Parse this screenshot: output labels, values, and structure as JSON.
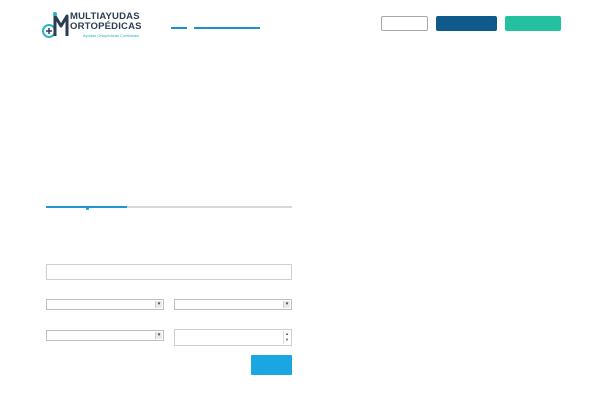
{
  "brand": {
    "name_line1": "MULTIAYUDAS",
    "name_line2": "ORTOPÉDICAS",
    "tagline": "Ayudas Ortopédicas Confiables",
    "colors": {
      "navy": "#2b3e51",
      "teal": "#25b5c8"
    }
  },
  "nav": {
    "links": [
      {
        "label": ""
      },
      {
        "label": ""
      }
    ],
    "accent": "#1f8fc7"
  },
  "header_buttons": [
    {
      "label": "",
      "style": "outline",
      "color": "#a8a8a8"
    },
    {
      "label": "",
      "style": "primary",
      "color": "#0e5a8a"
    },
    {
      "label": "",
      "style": "accent",
      "color": "#23c1a0"
    }
  ],
  "progress": {
    "value": 0.33,
    "color": "#1a98d1",
    "track_color": "#d8d8d8"
  },
  "form": {
    "text_field": {
      "value": "",
      "placeholder": ""
    },
    "select_1": {
      "selected": ""
    },
    "select_2": {
      "selected": ""
    },
    "select_3": {
      "selected": ""
    },
    "number_field": {
      "value": ""
    },
    "submit": {
      "label": "",
      "color": "#1aa6e0"
    }
  }
}
